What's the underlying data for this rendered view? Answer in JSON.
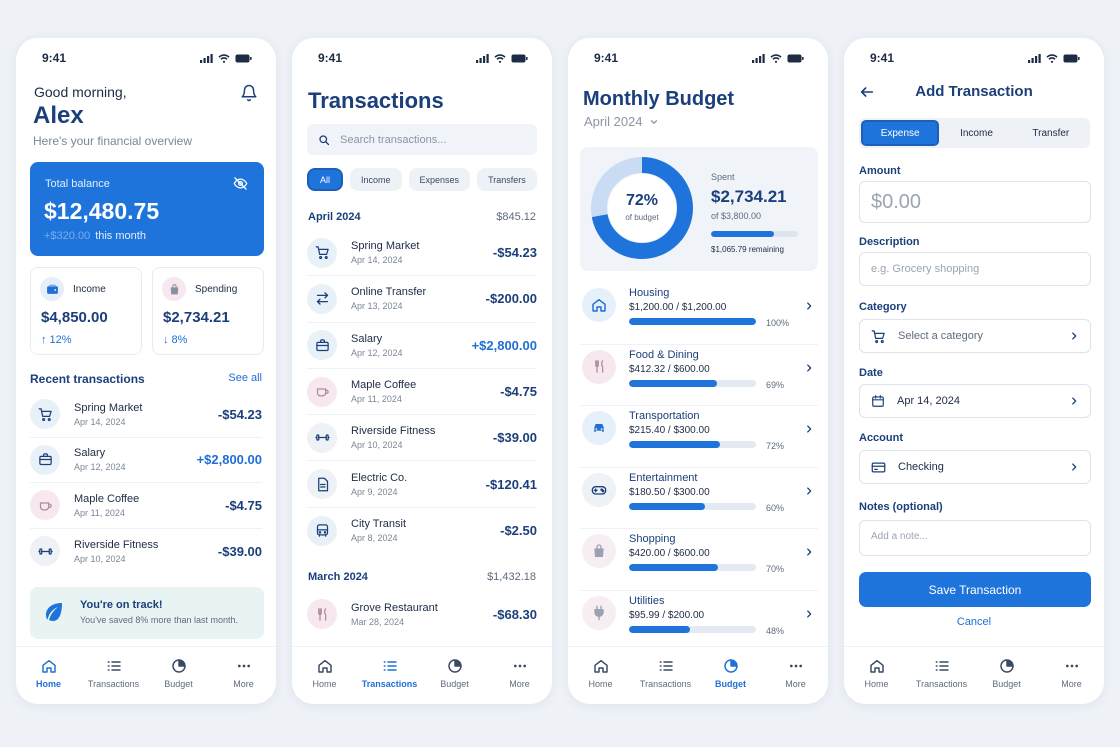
{
  "colors": {
    "accent": "#1f74db",
    "primary_text": "#1b3f7a",
    "soft_bg": "#eef2f7"
  },
  "status_bar": {
    "time": "9:41"
  },
  "nav": {
    "home": "Home",
    "transactions": "Transactions",
    "budget": "Budget",
    "more": "More"
  },
  "home": {
    "greeting": "Good morning,",
    "name": "Alex",
    "subtitle": "Here's your financial overview",
    "balance": {
      "label": "Total balance",
      "value": "$12,480.75",
      "change_faded": "+$320.00",
      "change_suffix": "this month"
    },
    "income": {
      "label": "Income",
      "value": "$4,850.00",
      "change": "↑ 12%"
    },
    "spending": {
      "label": "Spending",
      "value": "$2,734.21",
      "change": "↓ 8%"
    },
    "recent_title": "Recent transactions",
    "see_all": "See all",
    "recent": [
      {
        "icon": "cart-icon",
        "name": "Spring Market",
        "date": "Apr 14, 2024",
        "amount": "-$54.23"
      },
      {
        "icon": "briefcase-icon",
        "name": "Salary",
        "date": "Apr 12, 2024",
        "amount": "+$2,800.00"
      },
      {
        "icon": "coffee-icon",
        "name": "Maple Coffee",
        "date": "Apr 11, 2024",
        "amount": "-$4.75"
      },
      {
        "icon": "dumbbell-icon",
        "name": "Riverside Fitness",
        "date": "Apr 10, 2024",
        "amount": "-$39.00"
      }
    ],
    "on_track": {
      "title": "You're on track!",
      "text": "You've saved 8% more than last month."
    }
  },
  "transactions": {
    "title": "Transactions",
    "search_placeholder": "Search transactions...",
    "filters": [
      "All",
      "Income",
      "Expenses",
      "Transfers"
    ],
    "april": {
      "title": "April 2024",
      "total": "$845.12"
    },
    "april_items": [
      {
        "icon": "cart-icon",
        "name": "Spring Market",
        "date": "Apr 14, 2024",
        "amount": "-$54.23"
      },
      {
        "icon": "transfer-icon",
        "name": "Online Transfer",
        "date": "Apr 13, 2024",
        "amount": "-$200.00"
      },
      {
        "icon": "briefcase-icon",
        "name": "Salary",
        "date": "Apr 12, 2024",
        "amount": "+$2,800.00"
      },
      {
        "icon": "coffee-icon",
        "name": "Maple Coffee",
        "date": "Apr 11, 2024",
        "amount": "-$4.75"
      },
      {
        "icon": "dumbbell-icon",
        "name": "Riverside Fitness",
        "date": "Apr 10, 2024",
        "amount": "-$39.00"
      },
      {
        "icon": "document-icon",
        "name": "Electric Co.",
        "date": "Apr 9, 2024",
        "amount": "-$120.41"
      },
      {
        "icon": "bus-icon",
        "name": "City Transit",
        "date": "Apr 8, 2024",
        "amount": "-$2.50"
      }
    ],
    "march": {
      "title": "March 2024",
      "total": "$1,432.18"
    },
    "march_items": [
      {
        "icon": "fork-knife-icon",
        "name": "Grove Restaurant",
        "date": "Mar 28, 2024",
        "amount": "-$68.30"
      }
    ]
  },
  "budget": {
    "title": "Monthly Budget",
    "month": "April 2024",
    "percent": "72%",
    "percent_value": 0.72,
    "percent_sub": "of budget",
    "spent_label": "Spent",
    "spent_value": "$2,734.21",
    "spent_of": "of $3,800.00",
    "remaining": "$1,065.79 remaining",
    "categories": [
      {
        "icon": "home-icon",
        "name": "Housing",
        "amounts": "$1,200.00 / $1,200.00",
        "pct": "100%",
        "value": 1.0
      },
      {
        "icon": "fork-knife-icon",
        "name": "Food & Dining",
        "amounts": "$412.32 / $600.00",
        "pct": "69%",
        "value": 0.69
      },
      {
        "icon": "car-icon",
        "name": "Transportation",
        "amounts": "$215.40 / $300.00",
        "pct": "72%",
        "value": 0.72
      },
      {
        "icon": "gamepad-icon",
        "name": "Entertainment",
        "amounts": "$180.50 / $300.00",
        "pct": "60%",
        "value": 0.6
      },
      {
        "icon": "shopping-bag-icon",
        "name": "Shopping",
        "amounts": "$420.00 / $600.00",
        "pct": "70%",
        "value": 0.7
      },
      {
        "icon": "plug-icon",
        "name": "Utilities",
        "amounts": "$95.99 / $200.00",
        "pct": "48%",
        "value": 0.48
      }
    ]
  },
  "add": {
    "title": "Add Transaction",
    "segments": [
      "Expense",
      "Income",
      "Transfer"
    ],
    "amount_label": "Amount",
    "amount_placeholder": "$0.00",
    "description_label": "Description",
    "description_placeholder": "e.g. Grocery shopping",
    "category_label": "Category",
    "category_value": "Select a category",
    "date_label": "Date",
    "date_value": "Apr 14, 2024",
    "account_label": "Account",
    "account_value": "Checking",
    "notes_label": "Notes (optional)",
    "notes_placeholder": "Add a note...",
    "save": "Save Transaction",
    "cancel": "Cancel"
  }
}
